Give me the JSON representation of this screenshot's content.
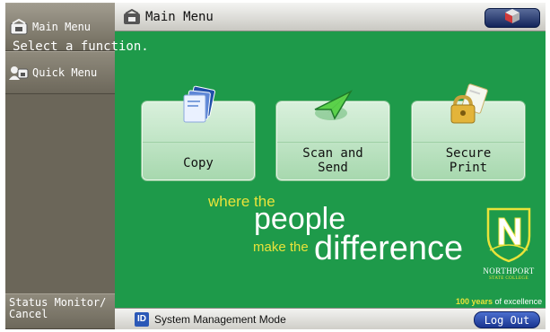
{
  "sidebar": {
    "main_menu": "Main Menu",
    "quick_menu": "Quick Menu",
    "status_monitor": "Status Monitor/\nCancel"
  },
  "header": {
    "title": "Main Menu",
    "shortcut_icon": "settings-counter-icon"
  },
  "instruction": "Select a function.",
  "functions": [
    {
      "label": "Copy",
      "icon": "copy-icon"
    },
    {
      "label": "Scan and\nSend",
      "icon": "send-icon"
    },
    {
      "label": "Secure\nPrint",
      "icon": "secure-print-icon"
    }
  ],
  "branding": {
    "where_the": "where the",
    "people": "people",
    "make_the": "make the",
    "difference": "difference",
    "college_name": "NORTHPORT",
    "college_sub": "STATE COLLEGE",
    "years_bold": "100 years",
    "years_rest": " of excellence",
    "colors": {
      "green": "#1e9a4a",
      "gold": "#e9e33a"
    }
  },
  "footer": {
    "badge": "ID",
    "mode": "System Management Mode",
    "logout": "Log Out"
  }
}
